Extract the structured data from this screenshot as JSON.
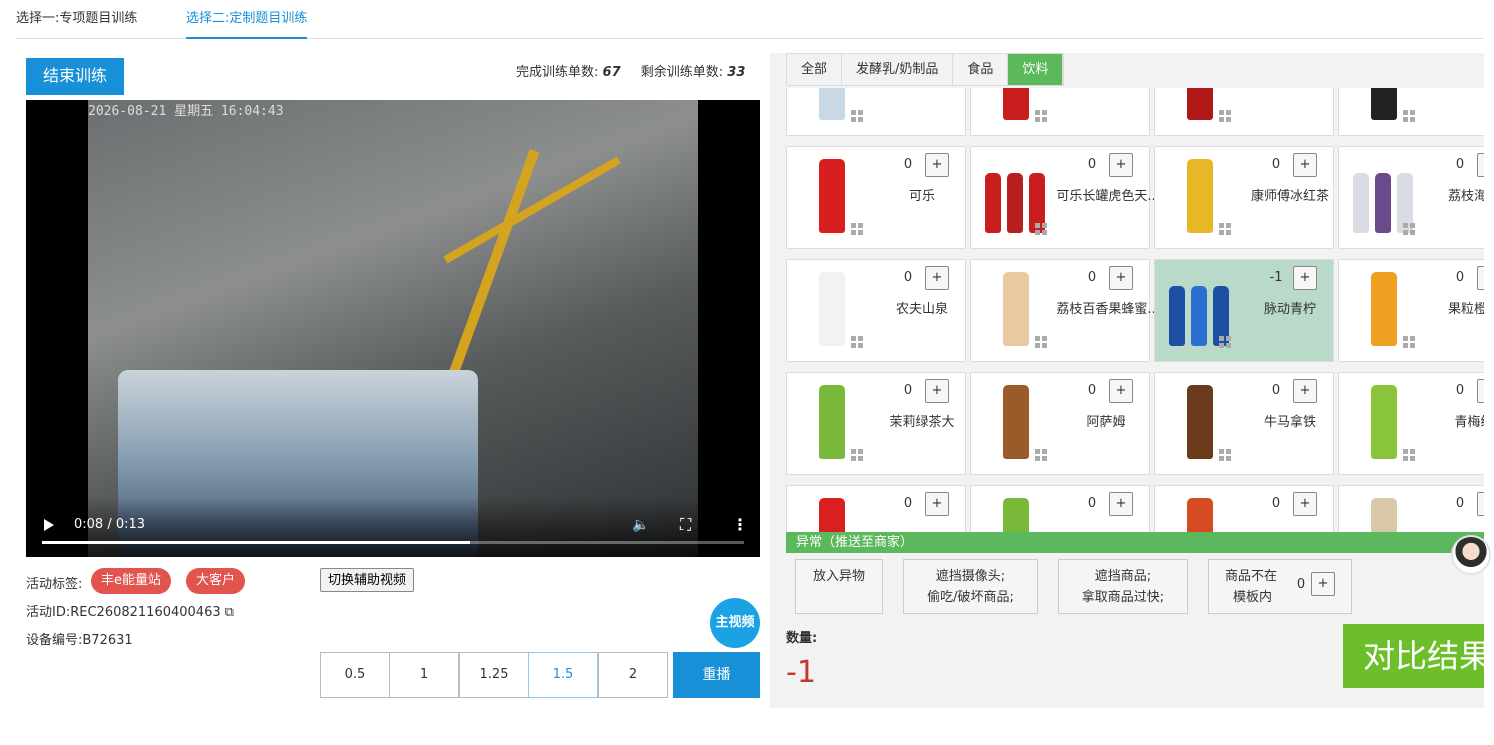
{
  "top_tabs": {
    "tab1": "选择一:专项题目训练",
    "tab2": "选择二:定制题目训练"
  },
  "end_button": "结束训练",
  "stats": {
    "done_label": "完成训练单数:",
    "done_value": "67",
    "remain_label": "剩余训练单数:",
    "remain_value": "33"
  },
  "video": {
    "timestamp": "2026-08-21 星期五 16:04:43",
    "timecode": "0:08 / 0:13",
    "progress_fraction": 0.61
  },
  "activity": {
    "tags_label": "活动标签:",
    "tags": [
      "丰e能量站",
      "大客户"
    ],
    "id_text": "活动ID:REC260821160400463",
    "device_text": "设备编号:B72631"
  },
  "switch_button": "切换辅助视频",
  "main_video_button": "主视频",
  "speeds": [
    "0.5",
    "1",
    "1.25",
    "1.5",
    "2"
  ],
  "active_speed": "1.5",
  "replay_button": "重播",
  "categories": [
    "全部",
    "发酵乳/奶制品",
    "食品",
    "饮料"
  ],
  "active_category": "饮料",
  "products": [
    {
      "name": "",
      "qty": ""
    },
    {
      "name": "",
      "qty": ""
    },
    {
      "name": "",
      "qty": ""
    },
    {
      "name": "",
      "qty": ""
    },
    {
      "name": "可乐",
      "qty": "0"
    },
    {
      "name": "可乐长罐虎色天..",
      "qty": "0"
    },
    {
      "name": "康师傅冰红茶",
      "qty": "0"
    },
    {
      "name": "荔枝海盐",
      "qty": "0"
    },
    {
      "name": "农夫山泉",
      "qty": "0"
    },
    {
      "name": "荔枝百香果蜂蜜..",
      "qty": "0"
    },
    {
      "name": "脉动青柠",
      "qty": "-1"
    },
    {
      "name": "果粒橙金",
      "qty": "0"
    },
    {
      "name": "茉莉绿茶大",
      "qty": "0"
    },
    {
      "name": "阿萨姆",
      "qty": "0"
    },
    {
      "name": "牛马拿铁",
      "qty": "0"
    },
    {
      "name": "青梅绿",
      "qty": "0"
    },
    {
      "name": "",
      "qty": "0"
    },
    {
      "name": "",
      "qty": "0"
    },
    {
      "name": "",
      "qty": "0"
    },
    {
      "name": "",
      "qty": "0"
    }
  ],
  "plus_label": "+",
  "anomaly": {
    "bar": "异常（推送至商家）",
    "buttons": [
      {
        "line1": "放入异物",
        "line2": ""
      },
      {
        "line1": "遮挡摄像头;",
        "line2": "偷吃/破坏商品;"
      },
      {
        "line1": "遮挡商品;",
        "line2": "拿取商品过快;"
      },
      {
        "line1": "商品不在",
        "line2": "模板内",
        "qty": "0"
      }
    ]
  },
  "quantity_label": "数量:",
  "quantity_value": "-1",
  "compare_button": "对比结果",
  "colors": {
    "accent_blue": "#1890d8",
    "tag_red": "#e2554f",
    "tab_green": "#5cb85c",
    "compare_green": "#6cbf2a",
    "qty_red": "#c0392b"
  }
}
